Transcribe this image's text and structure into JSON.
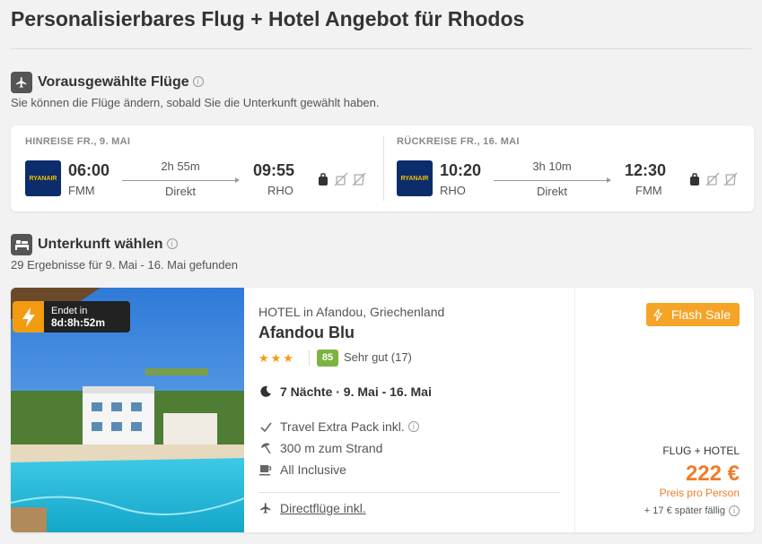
{
  "page": {
    "title": "Personalisierbares Flug + Hotel Angebot für Rhodos"
  },
  "flights_section": {
    "title": "Vorausgewählte Flüge",
    "subtitle": "Sie können die Flüge ändern, sobald Sie die Unterkunft gewählt haben.",
    "icon": "plane-icon"
  },
  "outbound": {
    "label": "HINREISE FR., 9. MAI",
    "airline": "RYANAIR",
    "dep_time": "06:00",
    "dep_airport": "FMM",
    "duration": "2h 55m",
    "stops": "Direkt",
    "arr_time": "09:55",
    "arr_airport": "RHO"
  },
  "return": {
    "label": "RÜCKREISE FR., 16. MAI",
    "airline": "RYANAIR",
    "dep_time": "10:20",
    "dep_airport": "RHO",
    "duration": "3h 10m",
    "stops": "Direkt",
    "arr_time": "12:30",
    "arr_airport": "FMM"
  },
  "accommodation_section": {
    "title": "Unterkunft wählen",
    "subtitle": "29 Ergebnisse für 9. Mai - 16. Mai gefunden",
    "icon": "bed-icon"
  },
  "hotel": {
    "timer_label": "Endet in",
    "timer_value": "8d:8h:52m",
    "type": "HOTEL in Afandou, Griechenland",
    "name": "Afandou Blu",
    "stars": "★★★",
    "star_count": 3,
    "score": "85",
    "score_text": "Sehr gut (17)",
    "nights": "7 Nächte · 9. Mai - 16. Mai",
    "features": [
      "Travel Extra Pack inkl.",
      "300 m zum Strand",
      "All Inclusive"
    ],
    "direct_flights": "Directflüge inkl."
  },
  "price": {
    "badge": "Flash Sale",
    "label": "FLUG + HOTEL",
    "amount": "222 €",
    "note": "Preis pro Person",
    "extra": "+ 17 € später fällig"
  },
  "colors": {
    "accent": "#f07c2b",
    "flash": "#f6a428",
    "score": "#7cb342",
    "airline": "#0d2c6b"
  }
}
